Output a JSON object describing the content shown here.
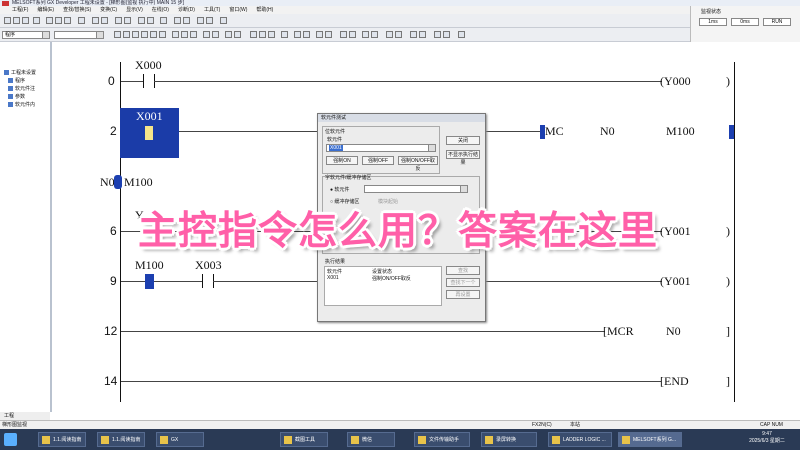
{
  "window": {
    "title": "MELSOFT系列 GX Developer 工程未设置 - [梯形图(监视 执行中)  MAIN  15 步]"
  },
  "menu": [
    "工程(F)",
    "编辑(E)",
    "查找/替换(S)",
    "变换(C)",
    "显示(V)",
    "在线(O)",
    "诊断(D)",
    "工具(T)",
    "窗口(W)",
    "帮助(H)"
  ],
  "toolbar": {
    "program_select": "程序"
  },
  "right_panel": {
    "label": "监视状态",
    "box1": "1ms",
    "box2": "0ms",
    "box3": "RUN"
  },
  "tree": {
    "nodes": [
      "工程未设置",
      "程序",
      "软元件注",
      "参数",
      "软元件内"
    ],
    "tab": "工程"
  },
  "ladder": {
    "rungs": [
      {
        "step": "0",
        "contact": "X000",
        "coil": "Y000"
      },
      {
        "step": "2",
        "contact": "X001",
        "instr": "MC",
        "arg1": "N0",
        "arg2": "M100"
      },
      {
        "step": "6",
        "contact": "Y",
        "coil": "Y001"
      },
      {
        "step": "9",
        "contact1": "M100",
        "contact2": "X003",
        "coil": "Y001"
      },
      {
        "step": "12",
        "instr": "MCR",
        "arg1": "N0"
      },
      {
        "step": "14",
        "instr": "END"
      }
    ],
    "nest_label": "N0",
    "nest_contact": "M100"
  },
  "dialog": {
    "title": "软元件测试",
    "group_bit": "位软元件",
    "label_device": "软元件",
    "field_device": "X001",
    "btn_force_on": "强制ON",
    "btn_force_off": "强制OFF",
    "btn_toggle": "强制ON/OFF取反",
    "btn_close": "关闭",
    "btn_hide": "不显示执行结果",
    "group_word": "字软元件/缓冲存储区",
    "radio_device": "软元件",
    "radio_buffer": "缓冲存储区",
    "label_module": "模块起始",
    "section_result": "执行结果",
    "col_device": "软元件",
    "col_setting": "设置状态",
    "row_device": "X001",
    "row_setting": "强制ON/OFF取反",
    "btn_find": "查找",
    "btn_find_next": "查找下一个",
    "btn_resetting": "再设置"
  },
  "caption": "主控指令怎么用？答案在这里",
  "status": {
    "left": "梯形图监视",
    "mid": "FX2N(C)",
    "mid2": "本站",
    "right": "CAP NUM"
  },
  "taskbar": {
    "items": [
      "1.1.阅读指南",
      "1.1.阅读指南",
      "GX",
      "截图工具",
      "微信",
      "文件传输助手",
      "录屏转换",
      "LADDER LOGIC ...",
      "MELSOFT系列 G..."
    ],
    "time": "9:47",
    "date": "2025/6/3 星期二"
  },
  "colors": {
    "caption": "#ff5fa8",
    "highlight": "#1b3ca8",
    "cursor_fill": "#f6e58a"
  }
}
